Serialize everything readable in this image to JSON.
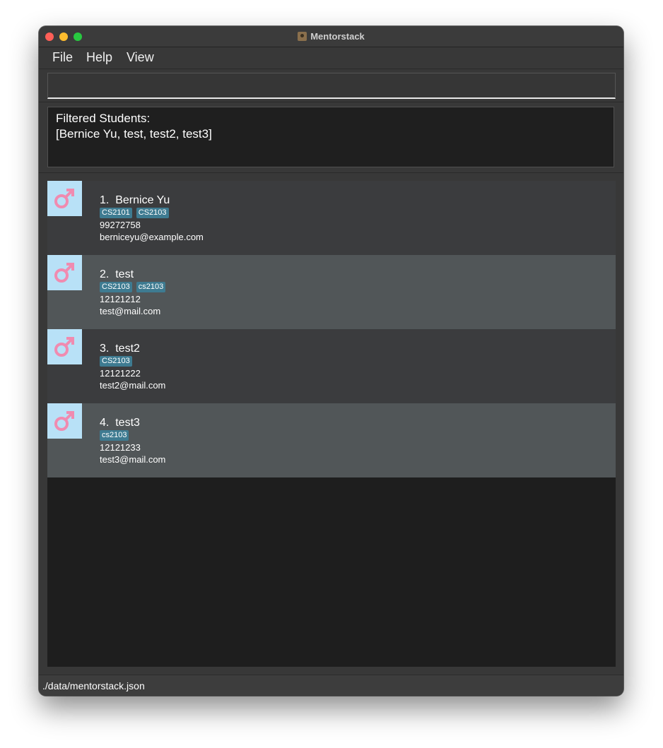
{
  "window": {
    "title": "Mentorstack",
    "app_icon": "contacts-book-icon"
  },
  "menu": [
    "File",
    "Help",
    "View"
  ],
  "command_box": {
    "value": "",
    "placeholder": ""
  },
  "result_display": {
    "lines": [
      "Filtered Students:",
      "[Bernice Yu, test, test2, test3]"
    ]
  },
  "students": [
    {
      "index": "1.",
      "name": "Bernice Yu",
      "tags": [
        "CS2101",
        "CS2103"
      ],
      "phone": "99272758",
      "email": "berniceyu@example.com",
      "gender_icon": "male-symbol-icon"
    },
    {
      "index": "2.",
      "name": "test",
      "tags": [
        "CS2103",
        "cs2103"
      ],
      "phone": "12121212",
      "email": "test@mail.com",
      "gender_icon": "male-symbol-icon"
    },
    {
      "index": "3.",
      "name": "test2",
      "tags": [
        "CS2103"
      ],
      "phone": "12121222",
      "email": "test2@mail.com",
      "gender_icon": "male-symbol-icon"
    },
    {
      "index": "4.",
      "name": "test3",
      "tags": [
        "cs2103"
      ],
      "phone": "12121233",
      "email": "test3@mail.com",
      "gender_icon": "male-symbol-icon"
    }
  ],
  "status_bar": {
    "file_path": "./data/mentorstack.json"
  },
  "colors": {
    "tag_background": "#3e7b91",
    "avatar_background": "#b8e1f7",
    "gender_symbol": "#f08bb0",
    "card_odd": "#3b3c3e",
    "card_even": "#515658"
  }
}
